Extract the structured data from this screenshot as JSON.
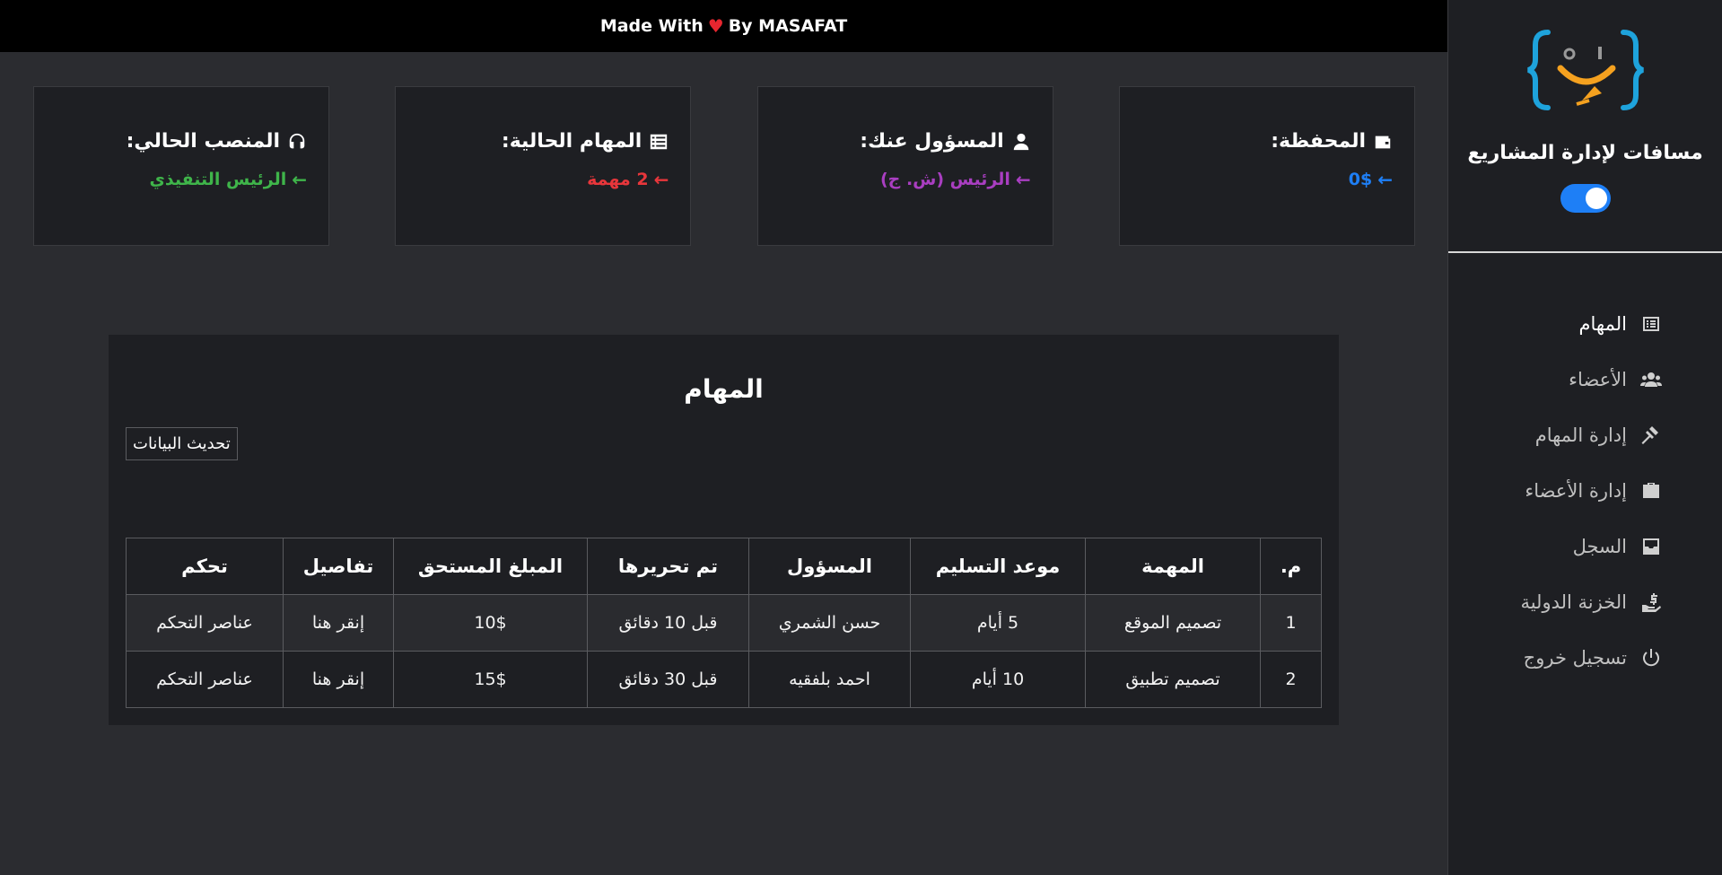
{
  "topbar": {
    "prefix": "Made With",
    "suffix": "By MASAFAT"
  },
  "sidebar": {
    "title": "مسافات لإدارة المشاريع",
    "items": [
      {
        "label": "المهام",
        "icon": "list-icon"
      },
      {
        "label": "الأعضاء",
        "icon": "users-icon"
      },
      {
        "label": "إدارة المهام",
        "icon": "gavel-icon"
      },
      {
        "label": "إدارة الأعضاء",
        "icon": "briefcase-icon"
      },
      {
        "label": "السجل",
        "icon": "inbox-icon"
      },
      {
        "label": "الخزنة الدولية",
        "icon": "hand-holding-dollar-icon"
      },
      {
        "label": "تسجيل خروج",
        "icon": "power-icon"
      }
    ]
  },
  "cards": [
    {
      "title": "المنصب الحالي:",
      "value": "الرئيس التنفيذي",
      "color": "#3fb54a",
      "icon": "headset-icon"
    },
    {
      "title": "المهام الحالية:",
      "value": "2 مهمة",
      "color": "#e8363b",
      "icon": "list-alt-icon"
    },
    {
      "title": "المسؤول عنك:",
      "value": "الرئيس (ش. ج)",
      "color": "#a93ec1",
      "icon": "user-icon"
    },
    {
      "title": "المحفظة:",
      "value": "0$",
      "color": "#1e7ff6",
      "icon": "wallet-icon"
    }
  ],
  "panel": {
    "title": "المهام",
    "refresh_label": "تحديث البيانات",
    "columns": [
      "م.",
      "المهمة",
      "موعد التسليم",
      "المسؤول",
      "تم تحريرها",
      "المبلغ المستحق",
      "تفاصيل",
      "تحكم"
    ],
    "rows": [
      [
        "1",
        "تصميم الموقع",
        "5 أيام",
        "حسن الشمري",
        "قبل 10 دقائق",
        "10$",
        "إنقر هنا",
        "عناصر التحكم"
      ],
      [
        "2",
        "تصميم تطبيق",
        "10 أيام",
        "احمد بلفقيه",
        "قبل 30 دقائق",
        "15$",
        "إنقر هنا",
        "عناصر التحكم"
      ]
    ]
  }
}
